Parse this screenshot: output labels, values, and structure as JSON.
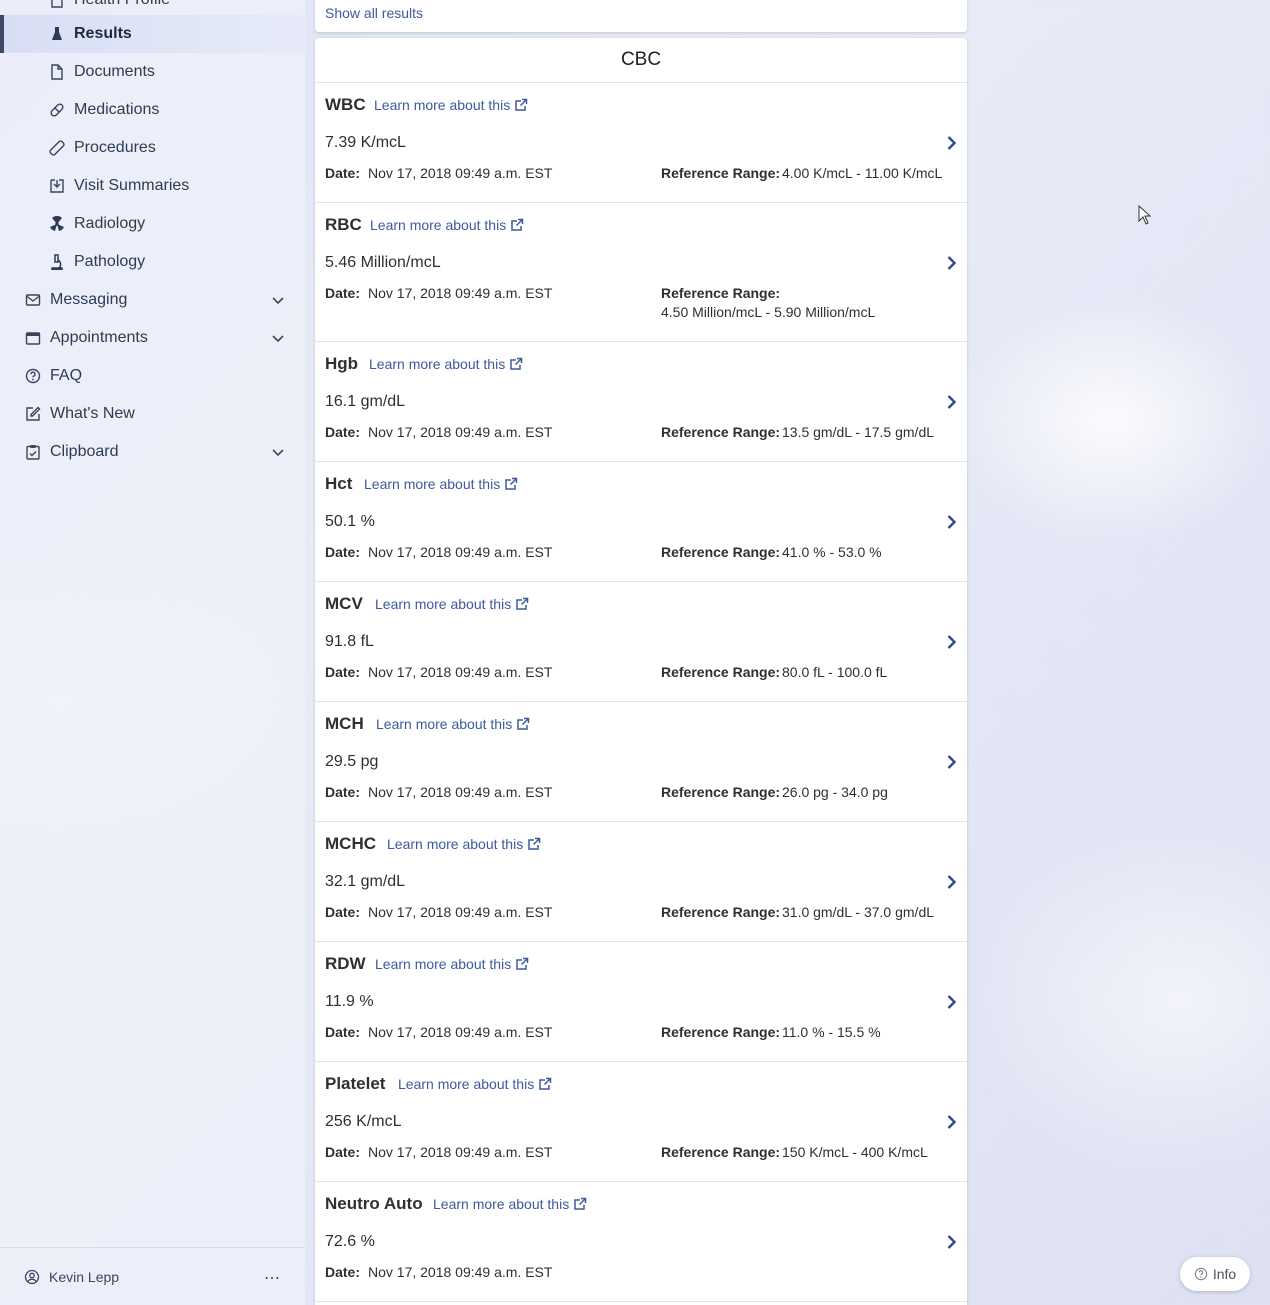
{
  "sidebar": {
    "items": [
      {
        "label": "Health Profile",
        "icon": "document-icon"
      },
      {
        "label": "Results",
        "icon": "flask-icon",
        "active": true
      },
      {
        "label": "Documents",
        "icon": "document-icon"
      },
      {
        "label": "Medications",
        "icon": "pill-icon"
      },
      {
        "label": "Procedures",
        "icon": "bandage-icon"
      },
      {
        "label": "Visit Summaries",
        "icon": "download-box-icon"
      },
      {
        "label": "Radiology",
        "icon": "radiation-icon"
      },
      {
        "label": "Pathology",
        "icon": "microscope-icon"
      },
      {
        "label": "Messaging",
        "icon": "mail-icon"
      },
      {
        "label": "Appointments",
        "icon": "calendar-icon"
      },
      {
        "label": "FAQ",
        "icon": "question-icon"
      },
      {
        "label": "What's New",
        "icon": "edit-icon"
      },
      {
        "label": "Clipboard",
        "icon": "clipboard-icon"
      }
    ],
    "user_name": "Kevin Lepp",
    "more_label": "⋯"
  },
  "top_card": {
    "link": "Show all results"
  },
  "panel": {
    "title": "CBC",
    "learn_label": "Learn more about this",
    "date_label": "Date:",
    "ref_label": "Reference Range:"
  },
  "results": [
    {
      "name": "WBC",
      "value": "7.39 K/mcL",
      "date": "Nov 17, 2018 09:49 a.m. EST",
      "range": "4.00 K/mcL - 11.00 K/mcL"
    },
    {
      "name": "RBC",
      "value": "5.46 Million/mcL",
      "date": "Nov 17, 2018 09:49 a.m. EST",
      "range": "4.50 Million/mcL - 5.90 Million/mcL"
    },
    {
      "name": "Hgb",
      "value": "16.1 gm/dL",
      "date": "Nov 17, 2018 09:49 a.m. EST",
      "range": "13.5 gm/dL - 17.5 gm/dL"
    },
    {
      "name": "Hct",
      "value": "50.1 %",
      "date": "Nov 17, 2018 09:49 a.m. EST",
      "range": "41.0 % - 53.0 %"
    },
    {
      "name": "MCV",
      "value": "91.8 fL",
      "date": "Nov 17, 2018 09:49 a.m. EST",
      "range": "80.0 fL - 100.0 fL"
    },
    {
      "name": "MCH",
      "value": "29.5 pg",
      "date": "Nov 17, 2018 09:49 a.m. EST",
      "range": "26.0 pg - 34.0 pg"
    },
    {
      "name": "MCHC",
      "value": "32.1 gm/dL",
      "date": "Nov 17, 2018 09:49 a.m. EST",
      "range": "31.0 gm/dL - 37.0 gm/dL"
    },
    {
      "name": "RDW",
      "value": "11.9 %",
      "date": "Nov 17, 2018 09:49 a.m. EST",
      "range": "11.0 % - 15.5 %"
    },
    {
      "name": "Platelet",
      "value": "256 K/mcL",
      "date": "Nov 17, 2018 09:49 a.m. EST",
      "range": "150 K/mcL - 400 K/mcL"
    },
    {
      "name": "Neutro Auto",
      "value": "72.6 %",
      "date": "Nov 17, 2018 09:49 a.m. EST",
      "range": ""
    }
  ],
  "info_button": {
    "label": "Info"
  }
}
